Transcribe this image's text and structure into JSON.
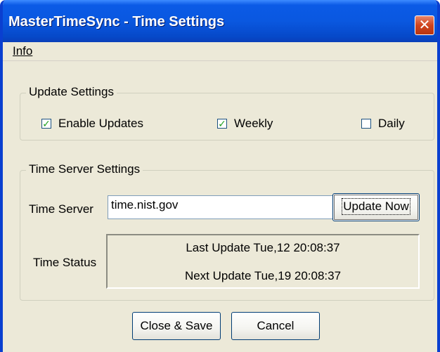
{
  "window": {
    "title": "MasterTimeSync - Time Settings",
    "close_glyph": "✕"
  },
  "menu": {
    "items": [
      {
        "label": "Info"
      }
    ]
  },
  "update_settings": {
    "title": "Update Settings",
    "options": [
      {
        "label": "Enable Updates",
        "checked": true
      },
      {
        "label": "Weekly",
        "checked": true
      },
      {
        "label": "Daily",
        "checked": false
      }
    ]
  },
  "time_server_settings": {
    "title": "Time Server Settings",
    "server_label": "Time Server",
    "server_value": "time.nist.gov",
    "update_button": "Update Now",
    "status_label": "Time Status",
    "last_update": "Last Update Tue,12 20:08:37",
    "next_update": "Next Update Tue,19 20:08:37"
  },
  "footer": {
    "close_save_button": "Close & Save",
    "cancel_button": "Cancel"
  },
  "colors": {
    "titlebar": "#0a58e0",
    "window_face": "#ece9d8",
    "close_button": "#d0441e",
    "check_mark": "#21a121"
  }
}
